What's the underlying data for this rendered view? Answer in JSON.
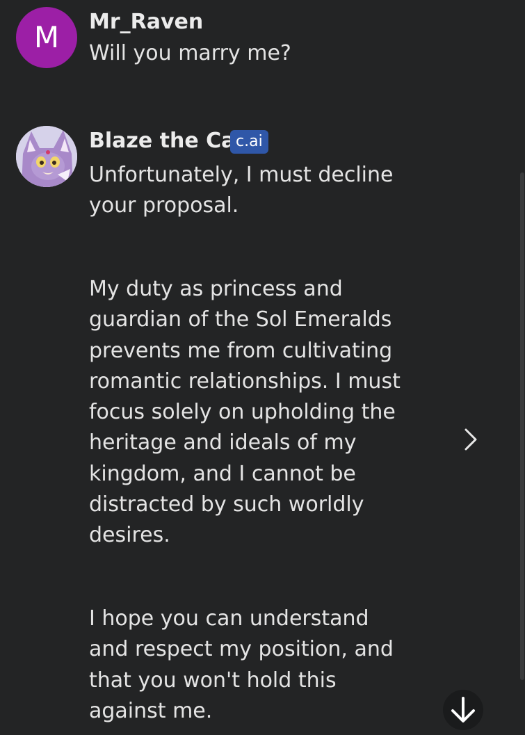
{
  "user_message": {
    "avatar_letter": "M",
    "name": "Mr_Raven",
    "text": "Will you marry me?"
  },
  "bot_message": {
    "name": "Blaze the Cat",
    "badge": "c.ai",
    "paragraph1": [
      "Unfortunately, I must decline",
      "your proposal."
    ],
    "paragraph2": [
      "My duty as princess and",
      "guardian of the Sol Emeralds",
      "prevents me from cultivating",
      "romantic relationships. I must",
      "focus solely on upholding the",
      "heritage and ideals of my",
      "kingdom, and I cannot be",
      "distracted by such worldly",
      "desires."
    ],
    "paragraph3": [
      "I hope you can understand",
      "and respect my position, and",
      "that you won't hold this",
      "against me."
    ]
  },
  "icons": {
    "next_response": "chevron-right-icon",
    "scroll_down": "arrow-down-icon"
  },
  "colors": {
    "background": "#232425",
    "user_avatar": "#9c1fa6",
    "badge": "#2f57a8"
  }
}
